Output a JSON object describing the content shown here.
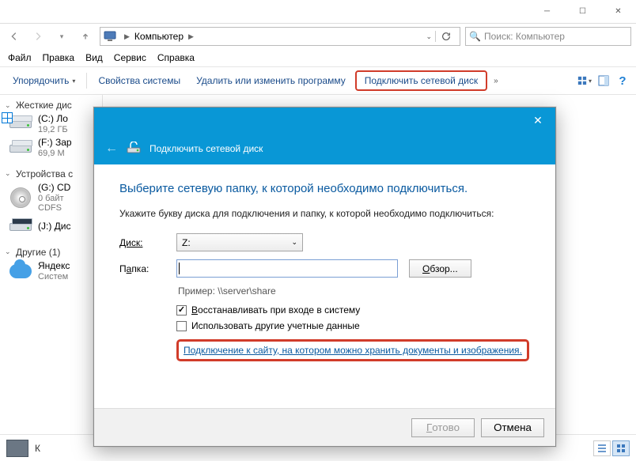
{
  "window": {
    "breadcrumb": "Компьютер",
    "search_placeholder": "Поиск: Компьютер"
  },
  "menubar": [
    "Файл",
    "Правка",
    "Вид",
    "Сервис",
    "Справка"
  ],
  "toolbar": {
    "organize": "Упорядочить",
    "sys_props": "Свойства системы",
    "uninstall": "Удалить или изменить программу",
    "map_drive": "Подключить сетевой диск",
    "more": "»"
  },
  "tree": {
    "group_hdd": "Жесткие дис",
    "drive_c": {
      "l1": "(C:) Ло",
      "l2": "19,2 ГБ"
    },
    "drive_f": {
      "l1": "(F:) Зар",
      "l2": "69,9 М"
    },
    "group_dev": "Устройства с",
    "drive_g": {
      "l1": "(G:) CD",
      "l2": "0 байт",
      "l3": "CDFS"
    },
    "drive_j": {
      "l1": "(J:) Дис"
    },
    "group_other": "Другие (1)",
    "yandex": {
      "l1": "Яндекс",
      "l2": "Систем"
    }
  },
  "statusbar": {
    "text": "К"
  },
  "dialog": {
    "title": "Подключить сетевой диск",
    "heading": "Выберите сетевую папку, к которой необходимо подключиться.",
    "instruction": "Укажите букву диска для подключения и папку, к которой необходимо подключиться:",
    "label_drive": "Диск:",
    "drive_value": "Z:",
    "label_folder_pre": "П",
    "label_folder_u": "а",
    "label_folder_post": "пка:",
    "browse_u": "О",
    "browse_post": "бзор...",
    "hint": "Пример: \\\\server\\share",
    "chk_restore_u": "В",
    "chk_restore_post": "осстанавливать при входе в систему",
    "chk_creds": "Использовать другие учетные данные",
    "link": "Подключение к сайту, на котором можно хранить документы и изображения",
    "btn_ok_u": "Г",
    "btn_ok_post": "отово",
    "btn_cancel": "Отмена"
  }
}
